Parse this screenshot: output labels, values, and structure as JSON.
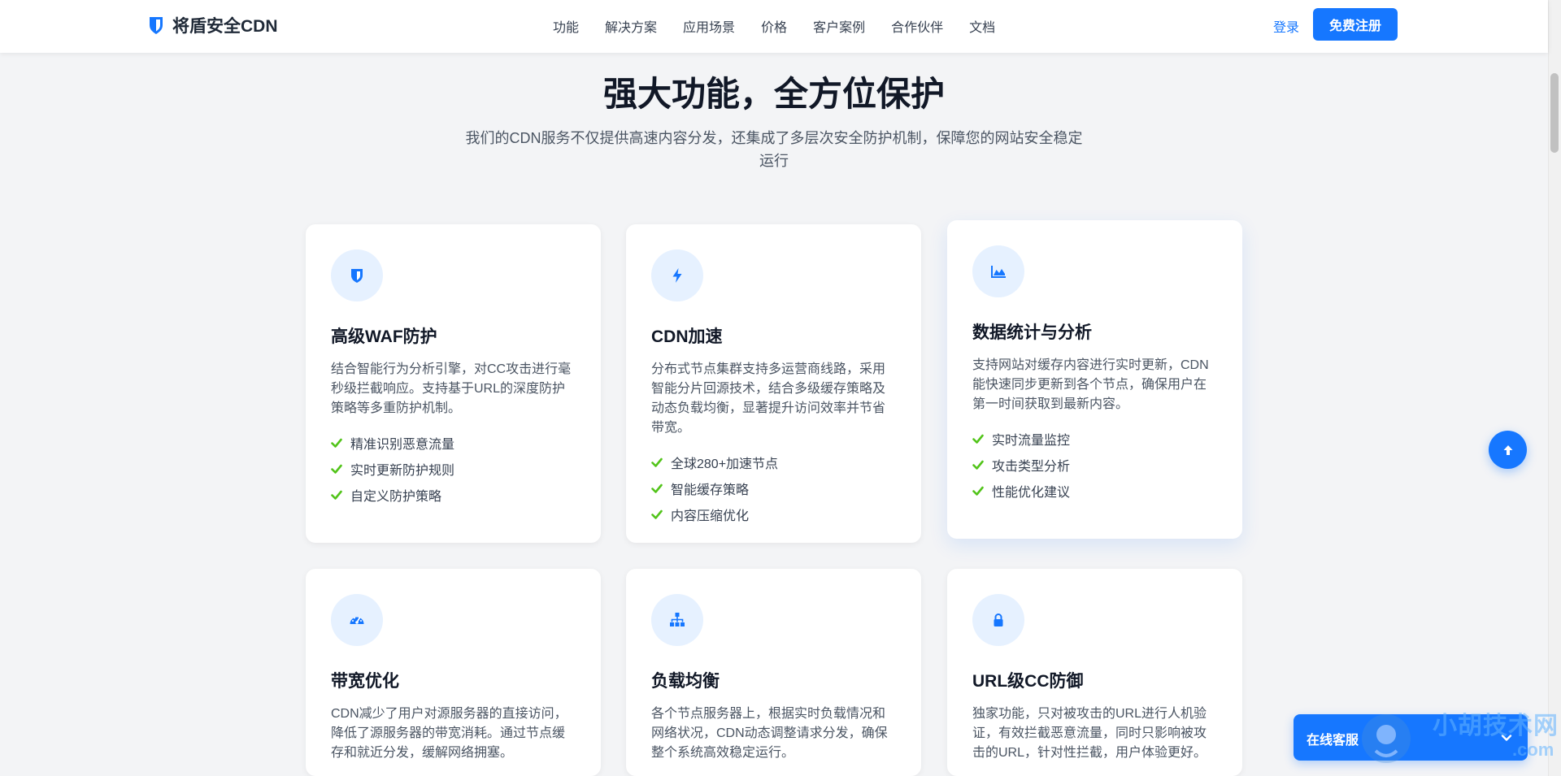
{
  "header": {
    "brand": "将盾安全CDN",
    "nav": [
      "功能",
      "解决方案",
      "应用场景",
      "价格",
      "客户案例",
      "合作伙伴",
      "文档"
    ],
    "login": "登录",
    "signup": "免费注册"
  },
  "hero": {
    "title": "强大功能，全方位保护",
    "subtitle": "我们的CDN服务不仅提供高速内容分发，还集成了多层次安全防护机制，保障您的网站安全稳定运行"
  },
  "features": [
    {
      "icon": "shield-icon",
      "title": "高级WAF防护",
      "desc": "结合智能行为分析引擎，对CC攻击进行毫秒级拦截响应。支持基于URL的深度防护策略等多重防护机制。",
      "items": [
        "精准识别恶意流量",
        "实时更新防护规则",
        "自定义防护策略"
      ]
    },
    {
      "icon": "bolt-icon",
      "title": "CDN加速",
      "desc": "分布式节点集群支持多运营商线路，采用智能分片回源技术，结合多级缓存策略及动态负载均衡，显著提升访问效率并节省带宽。",
      "items": [
        "全球280+加速节点",
        "智能缓存策略",
        "内容压缩优化"
      ]
    },
    {
      "icon": "area-chart-icon",
      "title": "数据统计与分析",
      "desc": "支持网站对缓存内容进行实时更新，CDN能快速同步更新到各个节点，确保用户在第一时间获取到最新内容。",
      "items": [
        "实时流量监控",
        "攻击类型分析",
        "性能优化建议"
      ]
    },
    {
      "icon": "gauge-icon",
      "title": "带宽优化",
      "desc": "CDN减少了用户对源服务器的直接访问，降低了源服务器的带宽消耗。通过节点缓存和就近分发，缓解网络拥塞。",
      "items": []
    },
    {
      "icon": "sitemap-icon",
      "title": "负载均衡",
      "desc": "各个节点服务器上，根据实时负载情况和网络状况，CDN动态调整请求分发，确保整个系统高效稳定运行。",
      "items": []
    },
    {
      "icon": "lock-icon",
      "title": "URL级CC防御",
      "desc": "独家功能，只对被攻击的URL进行人机验证，有效拦截恶意流量，同时只影响被攻击的URL，针对性拦截，用户体验更好。",
      "items": []
    }
  ],
  "chat": {
    "label": "在线客服"
  },
  "watermark": {
    "text": "小胡技术网",
    "sub": ".com"
  },
  "colors": {
    "accent": "#1677ff",
    "iconBg": "#e6f1ff",
    "check": "#52c41a"
  }
}
